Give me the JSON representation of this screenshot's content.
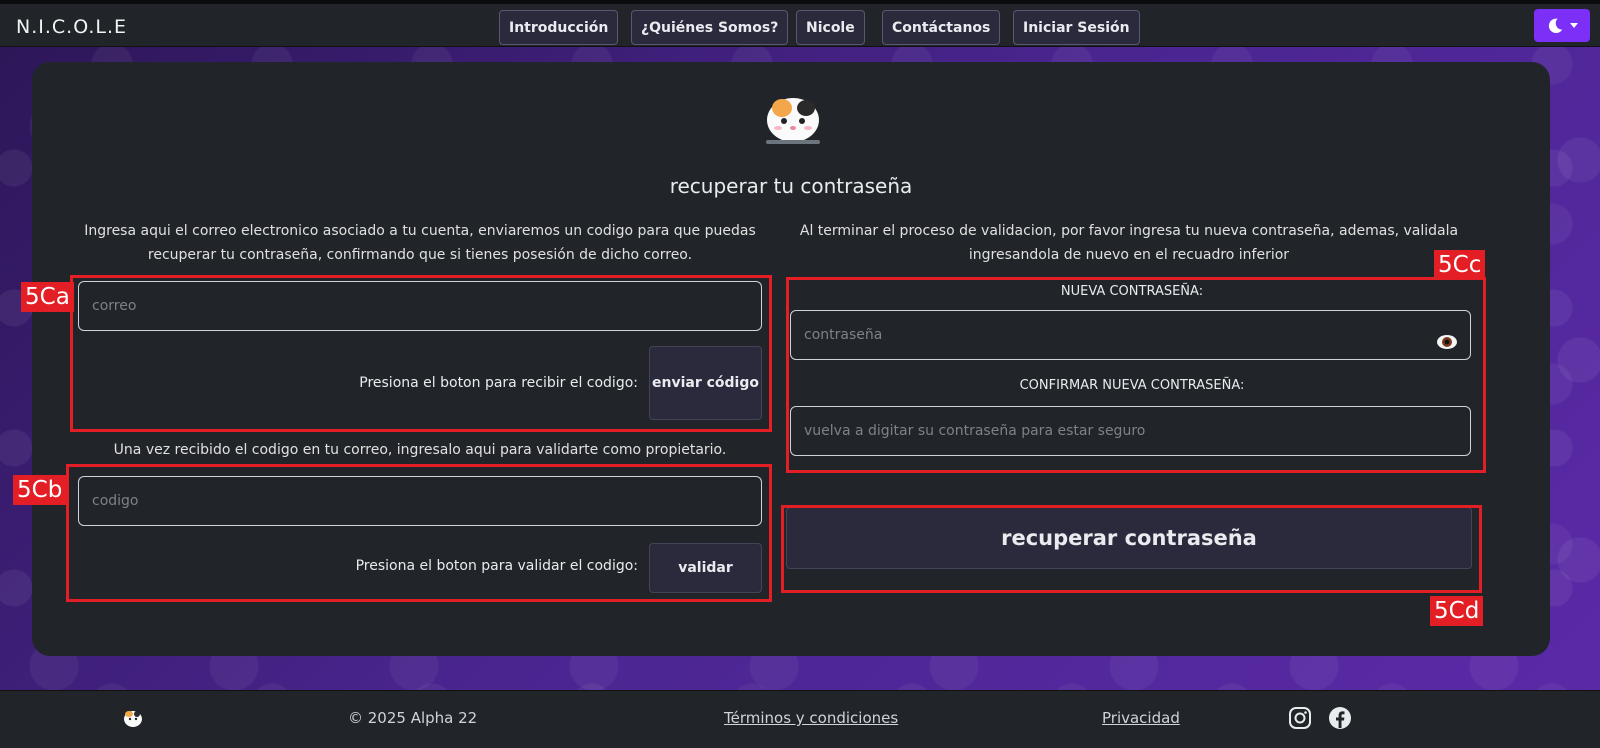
{
  "navbar": {
    "brand": "N.I.C.O.L.E",
    "links": [
      "Introducción",
      "¿Quiénes Somos?",
      "Nicole",
      "Contáctanos",
      "Iniciar Sesión"
    ],
    "theme_icon": "moon-icon",
    "accent_color": "#7b2ff7"
  },
  "main": {
    "title": "recuperar tu contraseña",
    "left_intro": "Ingresa aqui el correo electronico asociado a tu cuenta, enviaremos un codigo para que puedas recuperar tu contraseña, confirmando que si tienes posesión de dicho correo.",
    "email_placeholder": "correo",
    "send_label": "Presiona el boton para recibir el codigo:",
    "send_button": "enviar código",
    "code_intro": "Una vez recibido el codigo en tu correo, ingresalo aqui para validarte como propietario.",
    "code_placeholder": "codigo",
    "validate_label": "Presiona el boton para validar el codigo:",
    "validate_button": "validar",
    "right_intro": "Al terminar el proceso de validacion, por favor ingresa tu nueva contraseña, ademas, validala ingresandola de nuevo en el recuadro inferior",
    "new_password_label": "NUEVA CONTRASEÑA:",
    "new_password_placeholder": "contraseña",
    "confirm_label": "CONFIRMAR NUEVA CONTRASEÑA:",
    "confirm_placeholder": "vuelva a digitar su contraseña para estar seguro",
    "submit_button": "recuperar contraseña"
  },
  "annotations": {
    "a": "5Ca",
    "b": "5Cb",
    "c": "5Cc",
    "d": "5Cd",
    "color": "#e31e24"
  },
  "footer": {
    "copyright": "© 2025 Alpha 22",
    "terms": "Términos y condiciones",
    "privacy": "Privacidad",
    "social": [
      "instagram-icon",
      "facebook-icon"
    ]
  }
}
